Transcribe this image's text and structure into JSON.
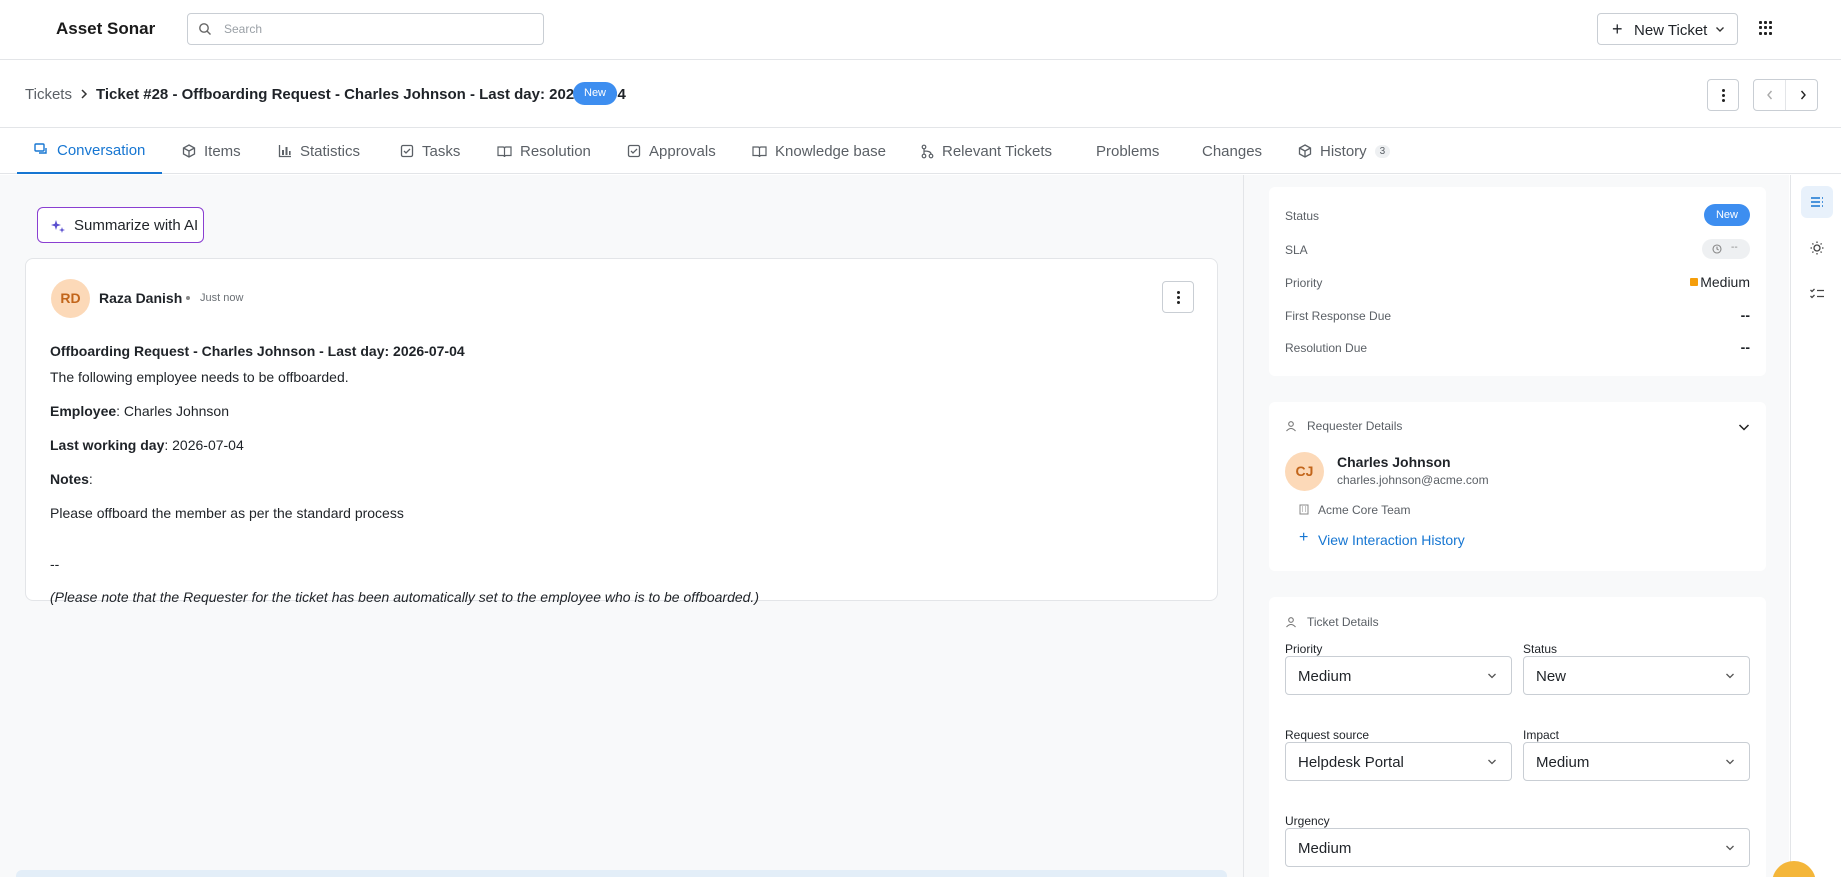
{
  "header": {
    "brand": "Asset Sonar",
    "search_placeholder": "Search",
    "new_ticket_label": "New Ticket"
  },
  "breadcrumb": {
    "root": "Tickets",
    "title": "Ticket #28 - Offboarding Request - Charles Johnson - Last day: 2026-07-04",
    "status_badge": "New"
  },
  "tabs": [
    {
      "label": "Conversation",
      "icon": "chat-icon",
      "active": true
    },
    {
      "label": "Items",
      "icon": "cube-icon"
    },
    {
      "label": "Statistics",
      "icon": "bar-chart-icon"
    },
    {
      "label": "Tasks",
      "icon": "checkbox-icon"
    },
    {
      "label": "Resolution",
      "icon": "book-icon"
    },
    {
      "label": "Approvals",
      "icon": "checkbox-icon"
    },
    {
      "label": "Knowledge base",
      "icon": "book-icon"
    },
    {
      "label": "Relevant Tickets",
      "icon": "branch-icon"
    },
    {
      "label": "Problems"
    },
    {
      "label": "Changes"
    },
    {
      "label": "History",
      "icon": "cube-icon",
      "count": "3"
    }
  ],
  "conversation": {
    "ai_button": "Summarize with AI",
    "message": {
      "author_initials": "RD",
      "author": "Raza Danish",
      "time": "Just now",
      "subject": "Offboarding Request - Charles Johnson - Last day: 2026-07-04",
      "intro": "The following employee needs to be offboarded.",
      "employee_label": "Employee",
      "employee_value": ": Charles Johnson",
      "lastday_label": "Last working day",
      "lastday_value": ": 2026-07-04",
      "notes_label": "Notes",
      "notes_colon": ":",
      "notes_body": "Please offboard the member as per the standard process",
      "separator": "--",
      "footnote": "(Please note that the Requester for the ticket has been automatically set to the employee who is to be offboarded.)"
    }
  },
  "summary": {
    "status_label": "Status",
    "status_value": "New",
    "sla_label": "SLA",
    "sla_value": "--",
    "priority_label": "Priority",
    "priority_value": "Medium",
    "first_response_label": "First Response Due",
    "first_response_value": "--",
    "resolution_label": "Resolution Due",
    "resolution_value": "--"
  },
  "requester": {
    "heading": "Requester Details",
    "initials": "CJ",
    "name": "Charles Johnson",
    "email": "charles.johnson@acme.com",
    "team": "Acme Core Team",
    "history_link": "View Interaction History"
  },
  "ticket_details": {
    "heading": "Ticket Details",
    "priority_label": "Priority",
    "priority_value": "Medium",
    "status_label": "Status",
    "status_value": "New",
    "source_label": "Request source",
    "source_value": "Helpdesk Portal",
    "impact_label": "Impact",
    "impact_value": "Medium",
    "urgency_label": "Urgency",
    "urgency_value": "Medium"
  },
  "colors": {
    "accent": "#1676d2",
    "status_new": "#3d8ef0",
    "priority_medium": "#f59e0b",
    "avatar_bg": "#fcd9b8",
    "ai_border": "#8a3fd1"
  }
}
